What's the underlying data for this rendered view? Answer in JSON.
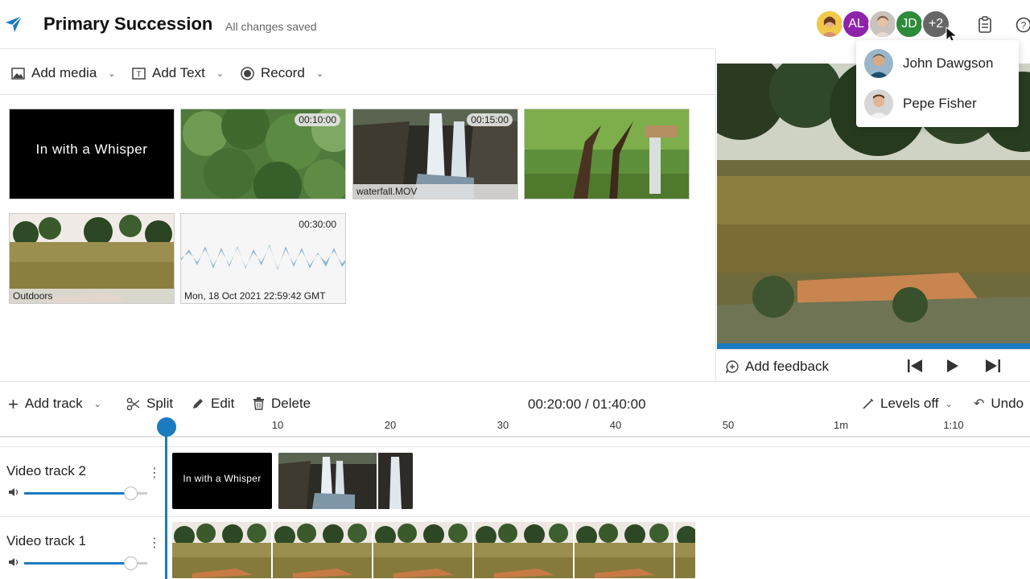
{
  "header": {
    "title": "Primary Succession",
    "status": "All changes saved",
    "collaborators": [
      "AL",
      "JD",
      "+2"
    ],
    "accent": "#1a7bbf"
  },
  "media_toolbar": {
    "add_media": "Add media",
    "add_text": "Add Text",
    "record": "Record"
  },
  "media": [
    {
      "title": "In with a Whisper"
    },
    {
      "duration": "00:10:00"
    },
    {
      "duration": "00:15:00",
      "caption": "waterfall.MOV"
    },
    {},
    {
      "caption": "Outdoors"
    },
    {
      "duration": "00:30:00",
      "caption": "Mon, 18 Oct 2021 22:59:42 GMT"
    }
  ],
  "popup": {
    "users": [
      "John Dawgson",
      "Pepe Fisher"
    ]
  },
  "preview": {
    "feedback": "Add feedback",
    "progress": 1.0
  },
  "timeline_toolbar": {
    "add_track": "Add track",
    "split": "Split",
    "edit": "Edit",
    "delete": "Delete",
    "timecode": "00:20:00 / 01:40:00",
    "levels": "Levels off",
    "undo": "Undo"
  },
  "ruler": [
    "10",
    "20",
    "30",
    "40",
    "50",
    "1m",
    "1:10"
  ],
  "tracks": [
    {
      "name": "Video track 2",
      "clip_text": "In with a Whisper",
      "volume": 0.86
    },
    {
      "name": "Video track 1",
      "volume": 0.86
    }
  ]
}
